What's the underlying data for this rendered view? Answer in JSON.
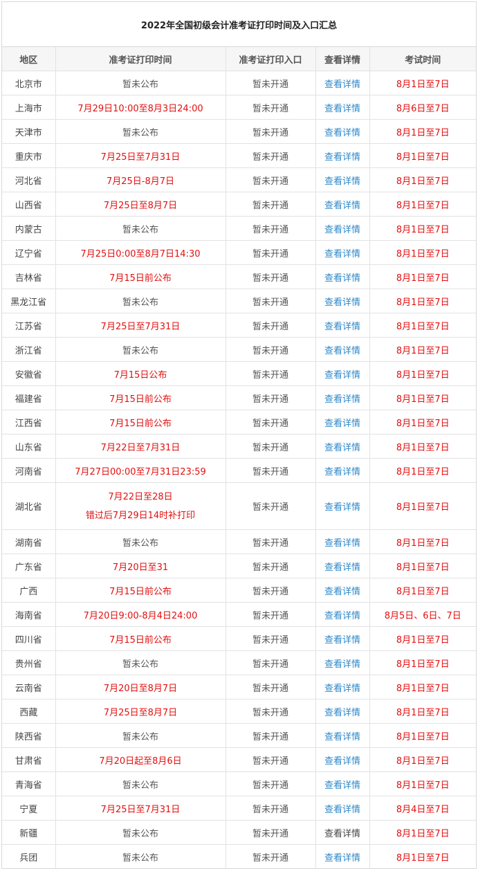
{
  "page": {
    "title": "2022年全国初级会计准考证打印时间及入口汇总"
  },
  "table": {
    "headers": [
      "地区",
      "准考证打印时间",
      "准考证打印入口",
      "查看详情",
      "考试时间"
    ],
    "rows": [
      {
        "region": "北京市",
        "print_time": [
          "暂未公布"
        ],
        "entry": "暂未开通",
        "detail": "查看详情",
        "detail_is_link": true,
        "exam_time": "8月1日至7日"
      },
      {
        "region": "上海市",
        "print_time": [
          "7月29日10:00至8月3日24:00"
        ],
        "entry": "暂未开通",
        "detail": "查看详情",
        "detail_is_link": true,
        "exam_time": "8月6日至7日"
      },
      {
        "region": "天津市",
        "print_time": [
          "暂未公布"
        ],
        "entry": "暂未开通",
        "detail": "查看详情",
        "detail_is_link": true,
        "exam_time": "8月1日至7日"
      },
      {
        "region": "重庆市",
        "print_time": [
          "7月25日至7月31日"
        ],
        "entry": "暂未开通",
        "detail": "查看详情",
        "detail_is_link": true,
        "exam_time": "8月1日至7日"
      },
      {
        "region": "河北省",
        "print_time": [
          "7月25日-8月7日"
        ],
        "entry": "暂未开通",
        "detail": "查看详情",
        "detail_is_link": true,
        "exam_time": "8月1日至7日"
      },
      {
        "region": "山西省",
        "print_time": [
          "7月25日至8月7日"
        ],
        "entry": "暂未开通",
        "detail": "查看详情",
        "detail_is_link": true,
        "exam_time": "8月1日至7日"
      },
      {
        "region": "内蒙古",
        "print_time": [
          "暂未公布"
        ],
        "entry": "暂未开通",
        "detail": "查看详情",
        "detail_is_link": true,
        "exam_time": "8月1日至7日"
      },
      {
        "region": "辽宁省",
        "print_time": [
          "7月25日0:00至8月7日14:30"
        ],
        "entry": "暂未开通",
        "detail": "查看详情",
        "detail_is_link": true,
        "exam_time": "8月1日至7日"
      },
      {
        "region": "吉林省",
        "print_time": [
          "7月15日前公布"
        ],
        "entry": "暂未开通",
        "detail": "查看详情",
        "detail_is_link": true,
        "exam_time": "8月1日至7日"
      },
      {
        "region": "黑龙江省",
        "print_time": [
          "暂未公布"
        ],
        "entry": "暂未开通",
        "detail": "查看详情",
        "detail_is_link": true,
        "exam_time": "8月1日至7日"
      },
      {
        "region": "江苏省",
        "print_time": [
          "7月25日至7月31日"
        ],
        "entry": "暂未开通",
        "detail": "查看详情",
        "detail_is_link": true,
        "exam_time": "8月1日至7日"
      },
      {
        "region": "浙江省",
        "print_time": [
          "暂未公布"
        ],
        "entry": "暂未开通",
        "detail": "查看详情",
        "detail_is_link": true,
        "exam_time": "8月1日至7日"
      },
      {
        "region": "安徽省",
        "print_time": [
          "7月15日公布"
        ],
        "entry": "暂未开通",
        "detail": "查看详情",
        "detail_is_link": true,
        "exam_time": "8月1日至7日"
      },
      {
        "region": "福建省",
        "print_time": [
          "7月15日前公布"
        ],
        "entry": "暂未开通",
        "detail": "查看详情",
        "detail_is_link": true,
        "exam_time": "8月1日至7日"
      },
      {
        "region": "江西省",
        "print_time": [
          "7月15日前公布"
        ],
        "entry": "暂未开通",
        "detail": "查看详情",
        "detail_is_link": true,
        "exam_time": "8月1日至7日"
      },
      {
        "region": "山东省",
        "print_time": [
          "7月22日至7月31日"
        ],
        "entry": "暂未开通",
        "detail": "查看详情",
        "detail_is_link": true,
        "exam_time": "8月1日至7日"
      },
      {
        "region": "河南省",
        "print_time": [
          "7月27日00:00至7月31日23:59"
        ],
        "entry": "暂未开通",
        "detail": "查看详情",
        "detail_is_link": true,
        "exam_time": "8月1日至7日"
      },
      {
        "region": "湖北省",
        "print_time": [
          "7月22日至28日",
          "错过后7月29日14时补打印"
        ],
        "entry": "暂未开通",
        "detail": "查看详情",
        "detail_is_link": true,
        "exam_time": "8月1日至7日"
      },
      {
        "region": "湖南省",
        "print_time": [
          "暂未公布"
        ],
        "entry": "暂未开通",
        "detail": "查看详情",
        "detail_is_link": true,
        "exam_time": "8月1日至7日"
      },
      {
        "region": "广东省",
        "print_time": [
          "7月20日至31"
        ],
        "entry": "暂未开通",
        "detail": "查看详情",
        "detail_is_link": true,
        "exam_time": "8月1日至7日"
      },
      {
        "region": "广西",
        "print_time": [
          "7月15日前公布"
        ],
        "entry": "暂未开通",
        "detail": "查看详情",
        "detail_is_link": true,
        "exam_time": "8月1日至7日"
      },
      {
        "region": "海南省",
        "print_time": [
          "7月20日9:00-8月4日24:00"
        ],
        "entry": "暂未开通",
        "detail": "查看详情",
        "detail_is_link": true,
        "exam_time": "8月5日、6日、7日"
      },
      {
        "region": "四川省",
        "print_time": [
          "7月15日前公布"
        ],
        "entry": "暂未开通",
        "detail": "查看详情",
        "detail_is_link": true,
        "exam_time": "8月1日至7日"
      },
      {
        "region": "贵州省",
        "print_time": [
          "暂未公布"
        ],
        "entry": "暂未开通",
        "detail": "查看详情",
        "detail_is_link": true,
        "exam_time": "8月1日至7日"
      },
      {
        "region": "云南省",
        "print_time": [
          "7月20日至8月7日"
        ],
        "entry": "暂未开通",
        "detail": "查看详情",
        "detail_is_link": true,
        "exam_time": "8月1日至7日"
      },
      {
        "region": "西藏",
        "print_time": [
          "7月25日至8月7日"
        ],
        "entry": "暂未开通",
        "detail": "查看详情",
        "detail_is_link": true,
        "exam_time": "8月1日至7日"
      },
      {
        "region": "陕西省",
        "print_time": [
          "暂未公布"
        ],
        "entry": "暂未开通",
        "detail": "查看详情",
        "detail_is_link": true,
        "exam_time": "8月1日至7日"
      },
      {
        "region": "甘肃省",
        "print_time": [
          "7月20日起至8月6日"
        ],
        "entry": "暂未开通",
        "detail": "查看详情",
        "detail_is_link": true,
        "exam_time": "8月1日至7日"
      },
      {
        "region": "青海省",
        "print_time": [
          "暂未公布"
        ],
        "entry": "暂未开通",
        "detail": "查看详情",
        "detail_is_link": true,
        "exam_time": "8月1日至7日"
      },
      {
        "region": "宁夏",
        "print_time": [
          "7月25日至7月31日"
        ],
        "entry": "暂未开通",
        "detail": "查看详情",
        "detail_is_link": true,
        "exam_time": "8月4日至7日"
      },
      {
        "region": "新疆",
        "print_time": [
          "暂未公布"
        ],
        "entry": "暂未开通",
        "detail": "查看详情",
        "detail_is_link": false,
        "exam_time": "8月1日至7日"
      },
      {
        "region": "兵团",
        "print_time": [
          "暂未公布"
        ],
        "entry": "暂未开通",
        "detail": "查看详情",
        "detail_is_link": true,
        "exam_time": "8月1日至7日"
      }
    ]
  },
  "colors": {
    "date_red": "#e20f0f",
    "link_blue": "#2c87c9",
    "pending_grey": "#555555",
    "header_bg": "#f6f6f6",
    "border": "#e2e2e2"
  }
}
